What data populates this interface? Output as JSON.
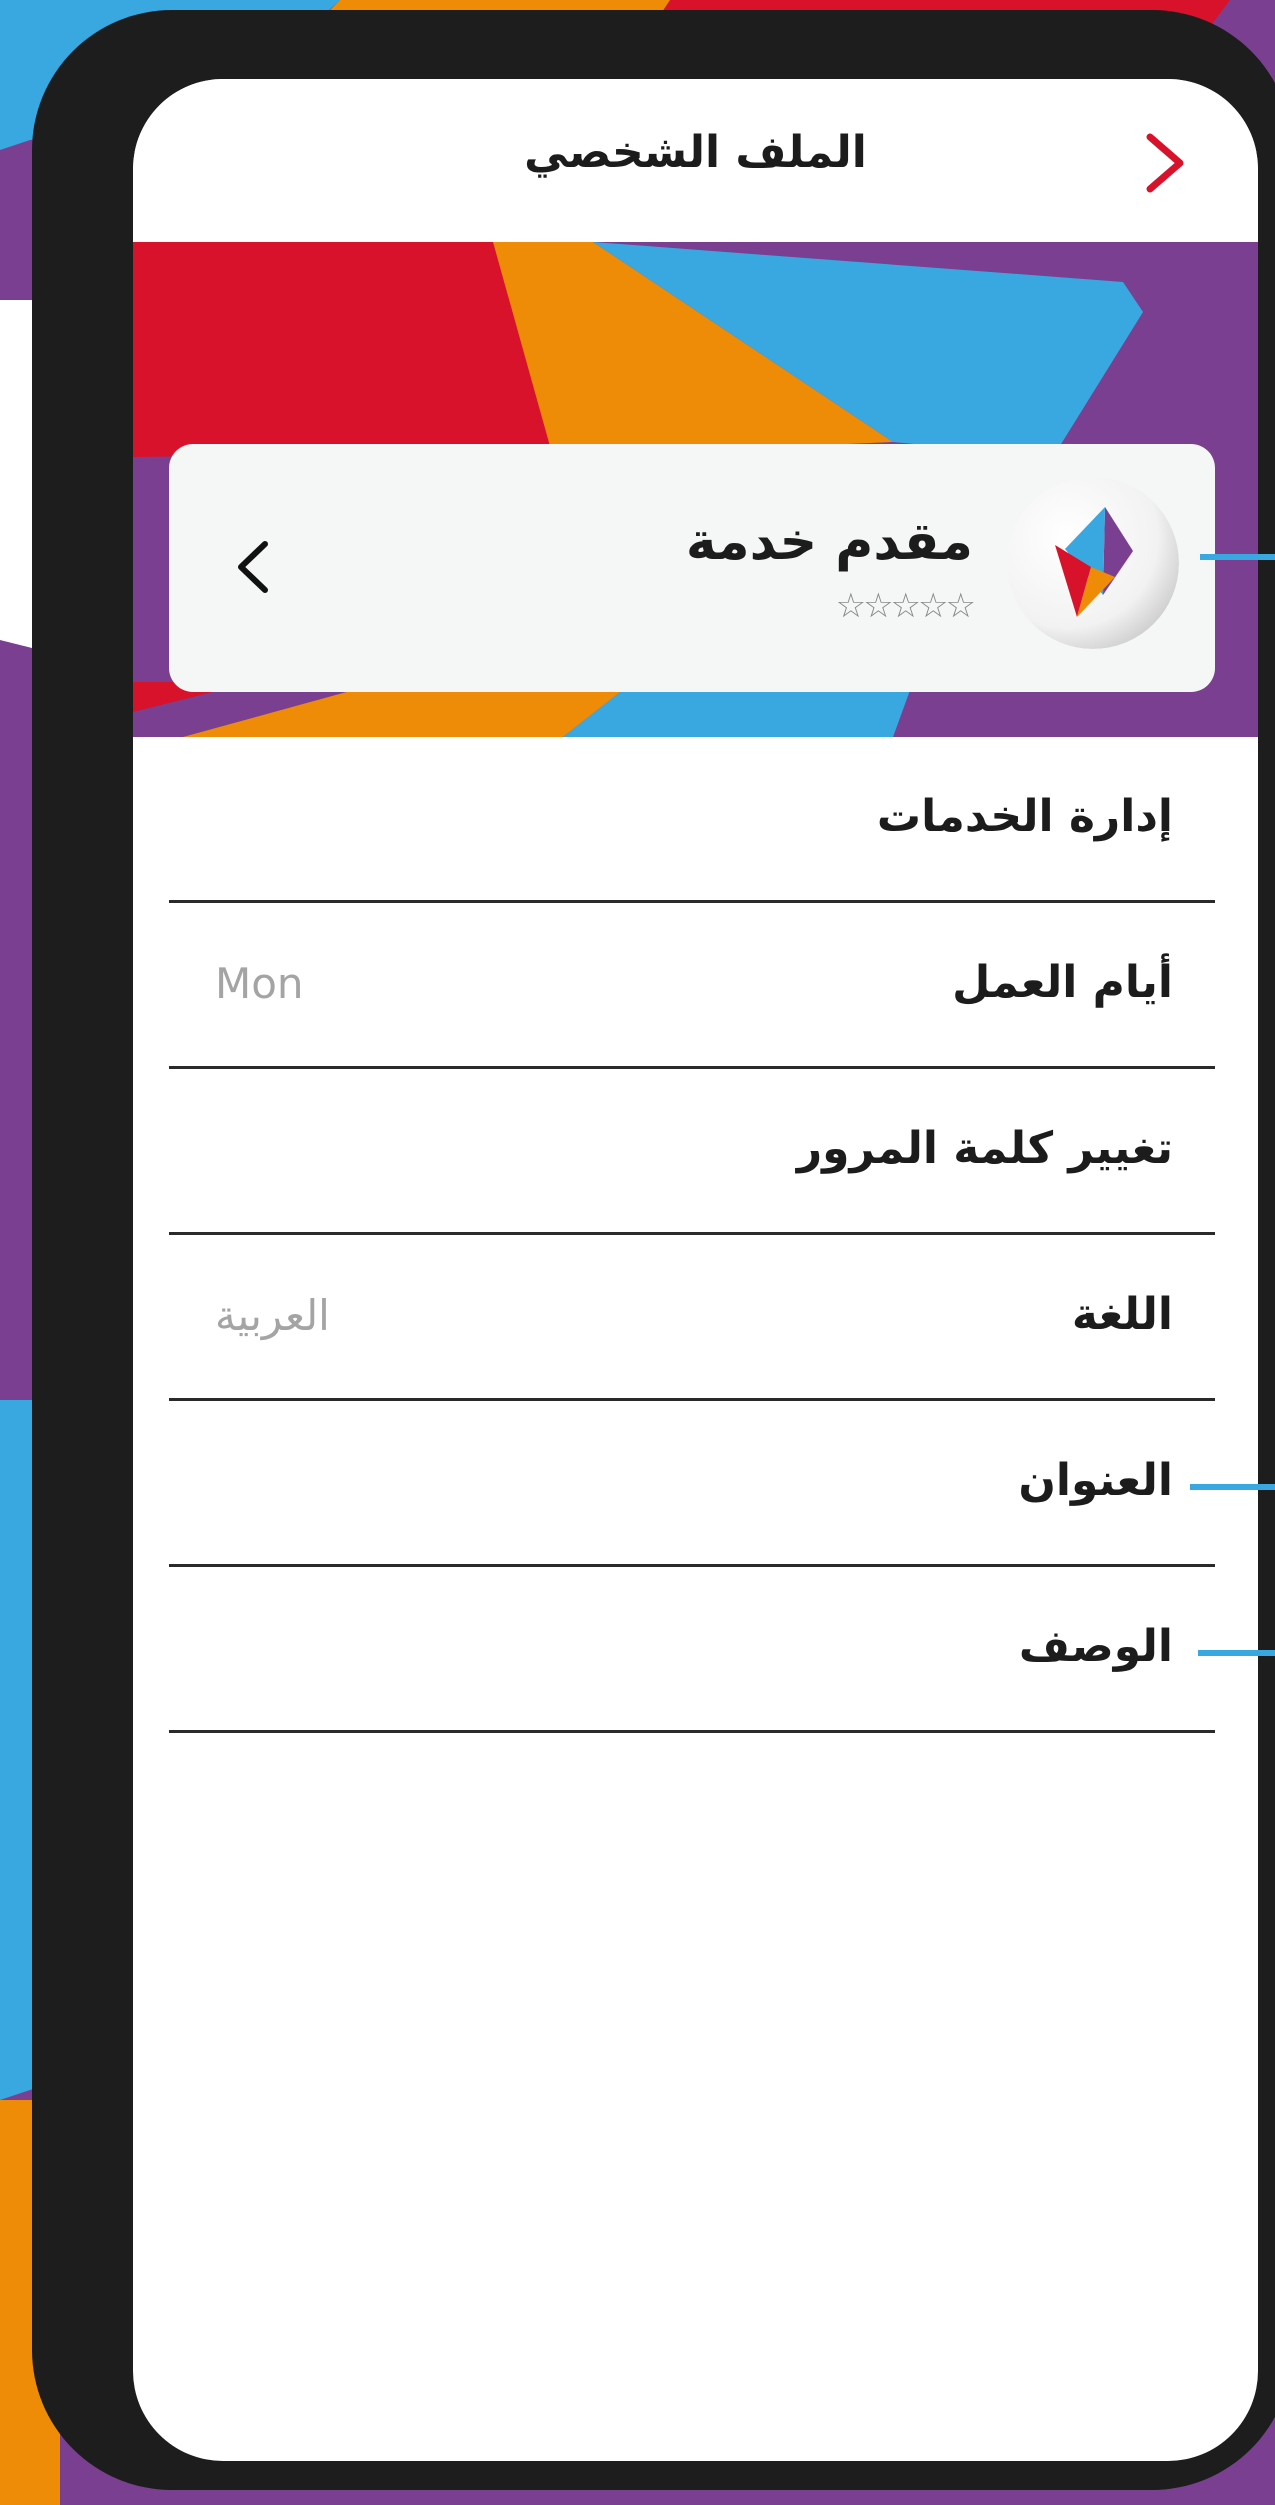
{
  "app_bar": {
    "title": "الملف الشخصي",
    "back_icon": "chevron-right-icon"
  },
  "provider": {
    "name": "مقدم خدمة",
    "rating": 0,
    "rating_max": 5,
    "stars": "☆☆☆☆☆",
    "open_icon": "chevron-left-icon"
  },
  "menu": [
    {
      "label": "إدارة الخدمات",
      "value": ""
    },
    {
      "label": "أيام العمل",
      "value": "Mon"
    },
    {
      "label": "تغيير كلمة المرور",
      "value": ""
    },
    {
      "label": "اللغة",
      "value": "العربية"
    },
    {
      "label": "العنوان",
      "value": ""
    },
    {
      "label": "الوصف",
      "value": ""
    }
  ],
  "colors": {
    "red": "#d8122b",
    "orange": "#ee8c07",
    "blue": "#3aa8e0",
    "purple": "#7b3f92",
    "frame": "#1d1d1d"
  }
}
